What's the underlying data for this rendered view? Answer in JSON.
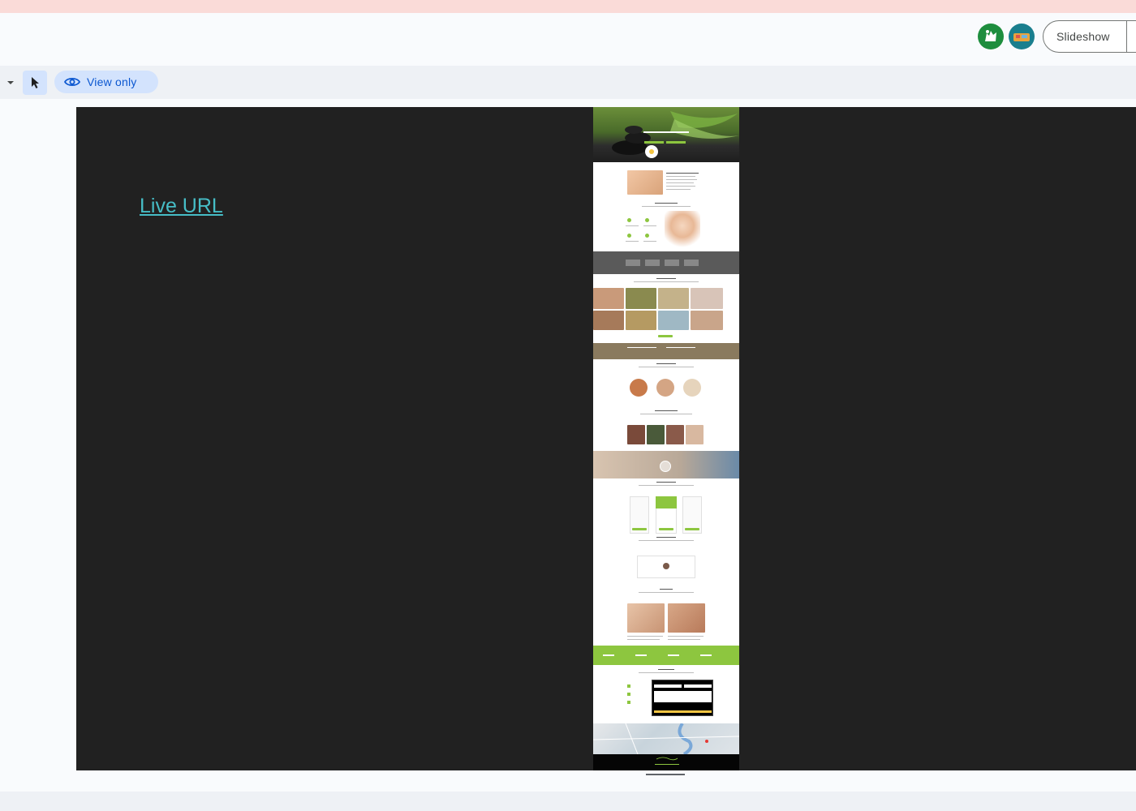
{
  "header": {
    "slideshow_label": "Slideshow"
  },
  "toolbar": {
    "view_only_label": "View only"
  },
  "slide": {
    "link_text": "Live URL",
    "link_color": "#46bdc6",
    "background": "#212121"
  },
  "colors": {
    "banner": "#fadbd8",
    "accent": "#0b57d0",
    "chip": "#d3e3fd",
    "site_green": "#8dc63f"
  }
}
